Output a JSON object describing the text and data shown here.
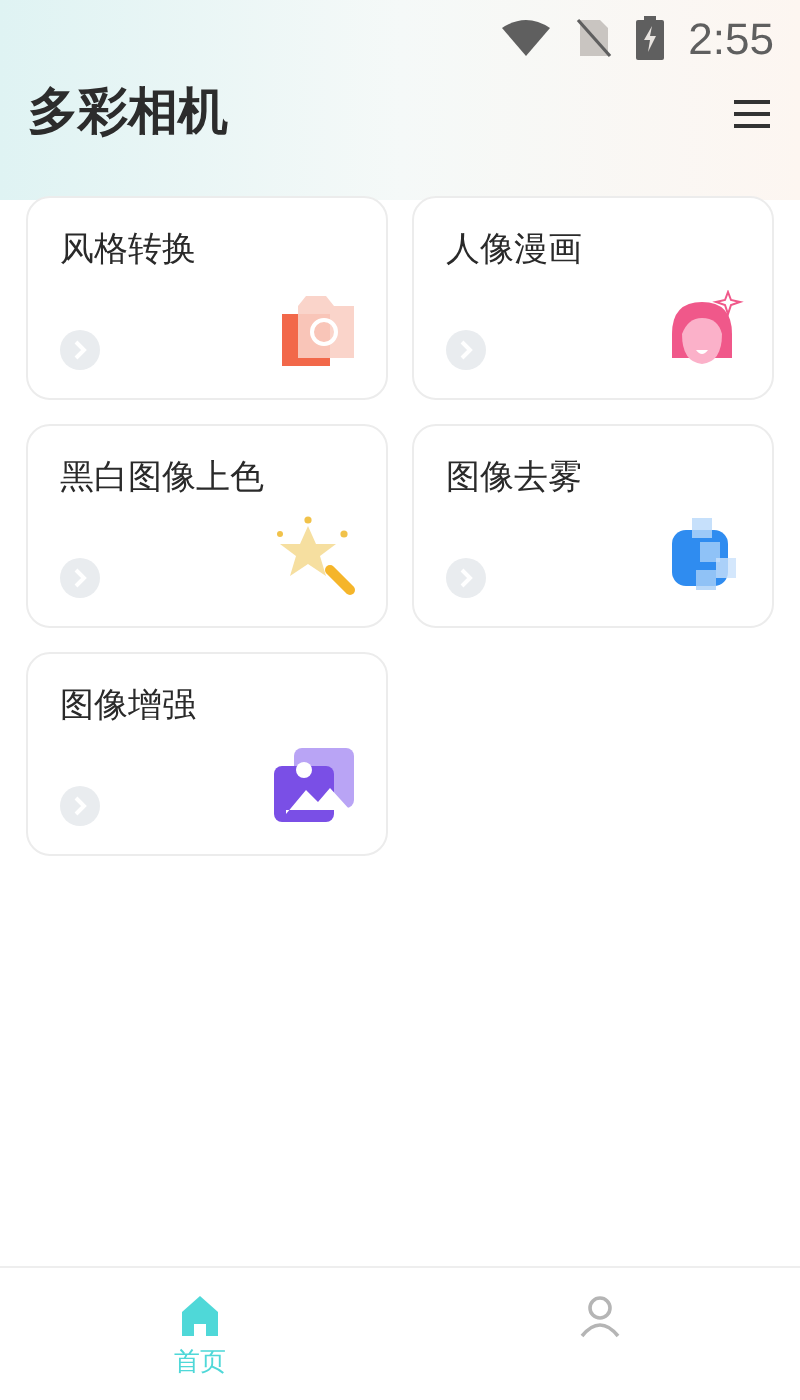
{
  "status_bar": {
    "time": "2:55"
  },
  "app_bar": {
    "title": "多彩相机"
  },
  "features": [
    {
      "label": "风格转换",
      "kind": "camera"
    },
    {
      "label": "人像漫画",
      "kind": "portrait"
    },
    {
      "label": "黑白图像上色",
      "kind": "wand"
    },
    {
      "label": "图像去雾",
      "kind": "dehaze"
    },
    {
      "label": "图像增强",
      "kind": "image"
    }
  ],
  "tabs": [
    {
      "label": "首页",
      "kind": "home",
      "selected": true
    },
    {
      "kind": "profile",
      "selected": false
    }
  ]
}
